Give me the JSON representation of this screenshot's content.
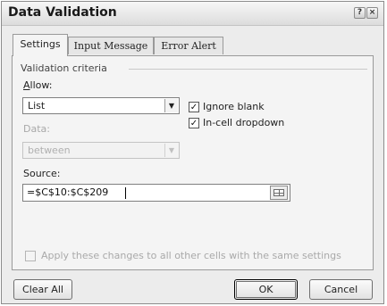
{
  "window": {
    "title": "Data Validation",
    "help_label": "?",
    "close_label": "×"
  },
  "tabs": [
    {
      "label": "Settings",
      "active": true
    },
    {
      "label": "Input Message",
      "active": false
    },
    {
      "label": "Error Alert",
      "active": false
    }
  ],
  "settings": {
    "group_label": "Validation criteria",
    "allow": {
      "label": "Allow:",
      "value": "List"
    },
    "data": {
      "label": "Data:",
      "value": "between",
      "disabled": true
    },
    "ignore_blank": {
      "label": "Ignore blank",
      "checked": true
    },
    "in_cell_dropdown": {
      "label": "In-cell dropdown",
      "checked": true
    },
    "source": {
      "label": "Source:",
      "value": "=$C$10:$C$209"
    },
    "apply_all": {
      "label": "Apply these changes to all other cells with the same settings",
      "checked": false,
      "disabled": true
    }
  },
  "buttons": {
    "clear_all": "Clear All",
    "ok": "OK",
    "cancel": "Cancel"
  }
}
